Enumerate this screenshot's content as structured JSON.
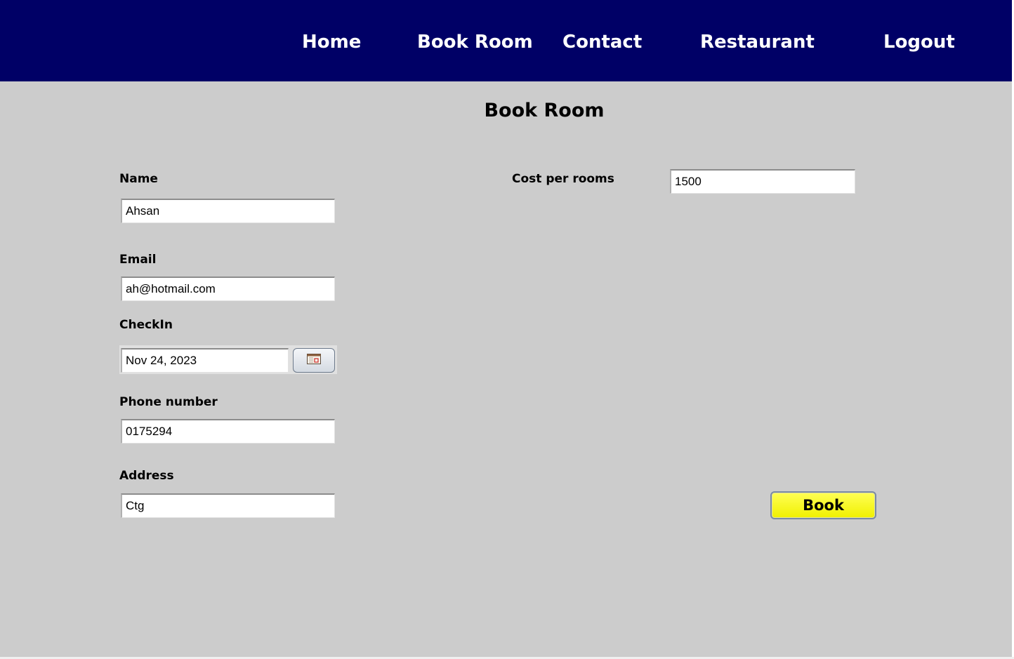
{
  "nav": {
    "items": [
      {
        "label": "Home"
      },
      {
        "label": "Book Room"
      },
      {
        "label": "Contact"
      },
      {
        "label": "Restaurant"
      },
      {
        "label": "Logout"
      }
    ]
  },
  "page": {
    "title": "Book Room"
  },
  "form": {
    "name": {
      "label": "Name",
      "value": "Ahsan"
    },
    "email": {
      "label": "Email",
      "value": "ah@hotmail.com"
    },
    "checkin": {
      "label": "CheckIn",
      "value": "Nov 24, 2023"
    },
    "phone": {
      "label": "Phone number",
      "value": "0175294"
    },
    "address": {
      "label": "Address",
      "value": "Ctg"
    },
    "cost": {
      "label": "Cost per rooms",
      "value": "1500"
    },
    "book_label": "Book"
  },
  "icons": {
    "calendar": "calendar-icon"
  },
  "colors": {
    "navbar": "#000066",
    "background": "#cccccc",
    "book_button": "#ffff00"
  }
}
